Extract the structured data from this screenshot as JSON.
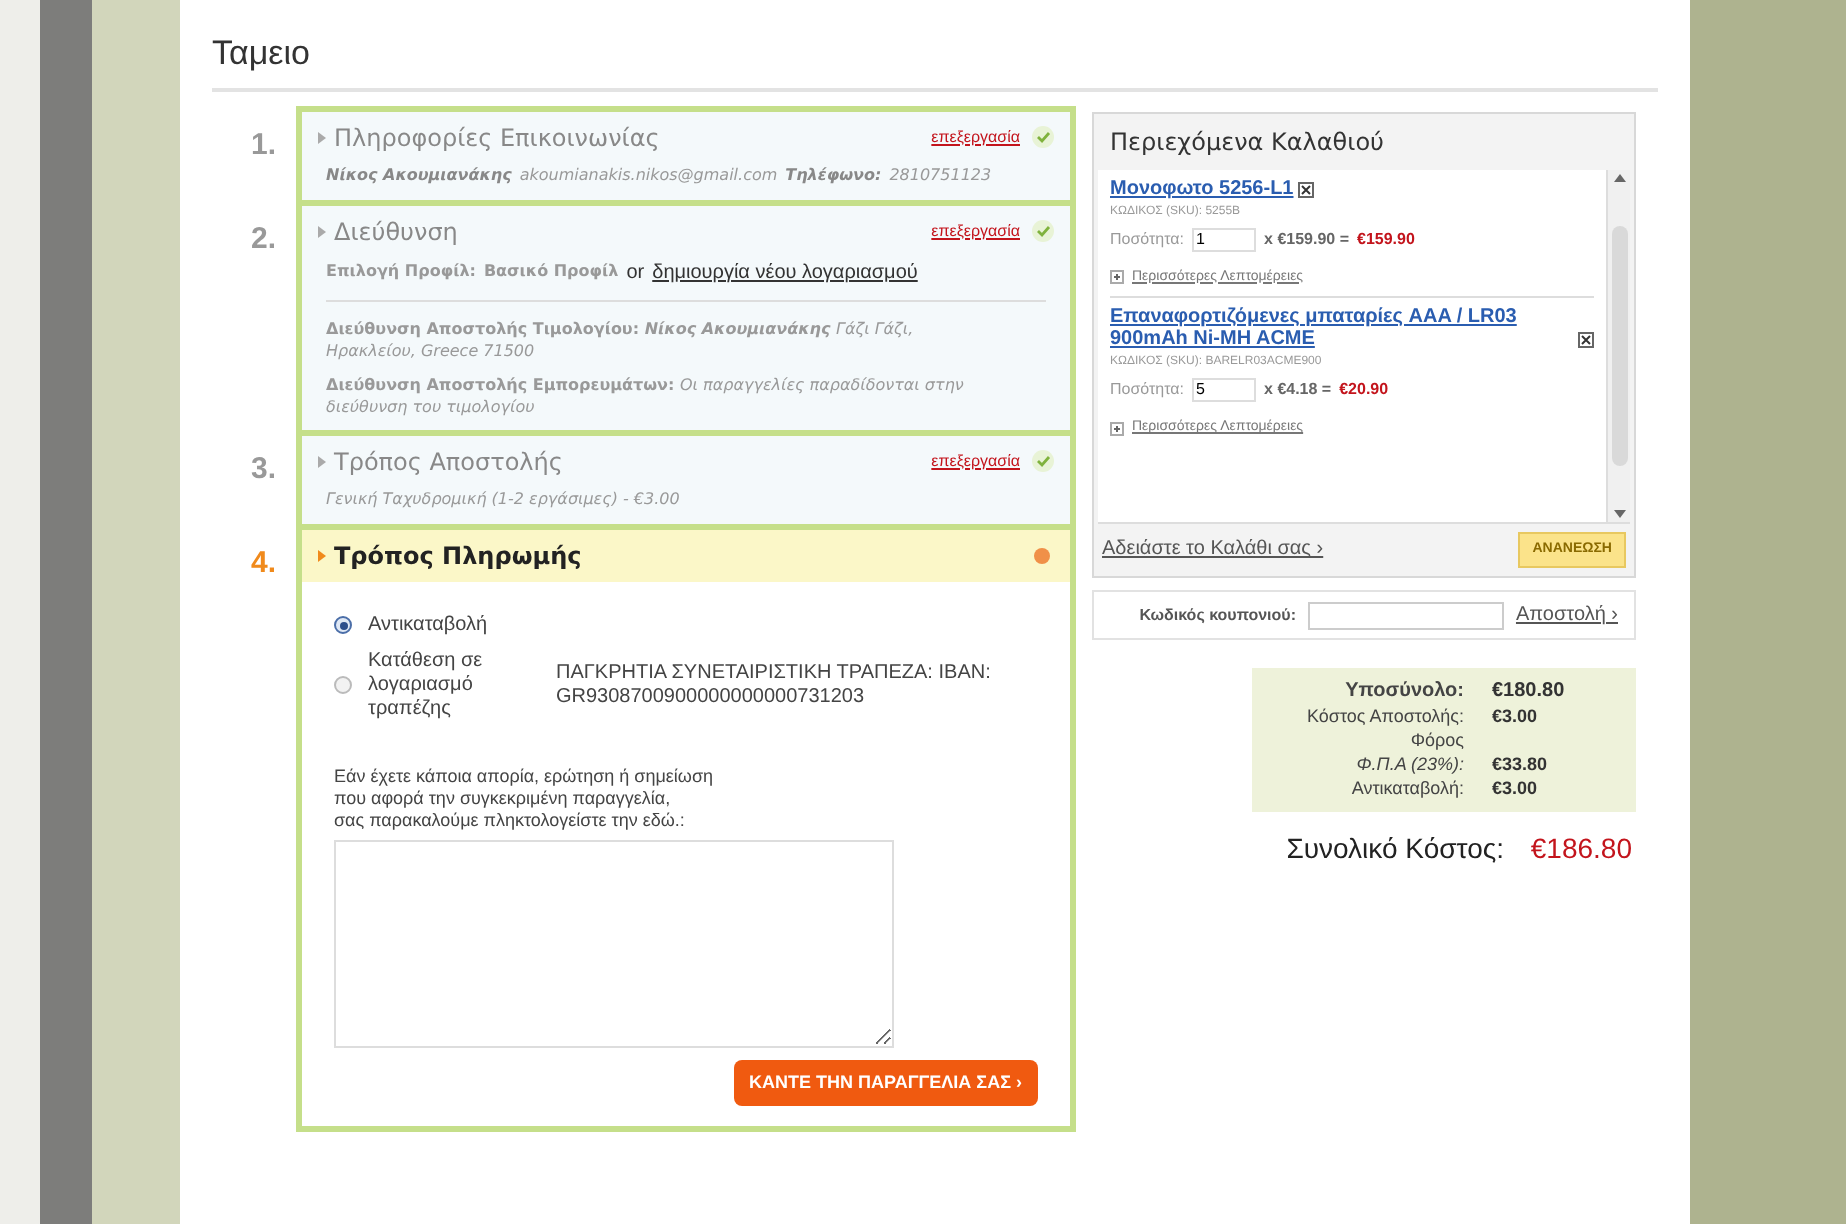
{
  "page_title": "Ταμειο",
  "steps": [
    {
      "number": "1.",
      "title": "Πληροφορίες Επικοινωνίας",
      "completed": true,
      "active": false,
      "edit_link": "επεξεργασία",
      "kind": "contact",
      "name": "Νίκος Ακουμιανάκης",
      "email": "akoumianakis.nikos@gmail.com",
      "phone_label": "Τηλέφωνο:",
      "phone": "2810751123"
    },
    {
      "number": "2.",
      "title": "Διεύθυνση",
      "completed": true,
      "active": false,
      "edit_link": "επεξεργασία",
      "kind": "address",
      "profile_label": "Επιλογή Προφίλ:",
      "profile_value": "Βασικό Προφίλ",
      "or": "or",
      "new_account_link": "δημιουργία νέου λογαριασμού",
      "billing_label": "Διεύθυνση Αποστολής Τιμολογίου:",
      "billing_name": "Νίκος Ακουμιανάκης",
      "billing_address": "Γάζι Γάζι, Ηρακλείου, Greece 71500",
      "shipping_label": "Διεύθυνση Αποστολής Εμπορευμάτων:",
      "shipping_note": "Οι παραγγελίες παραδίδονται στην διεύθυνση του τιμολογίου"
    },
    {
      "number": "3.",
      "title": "Τρόπος Αποστολής",
      "completed": true,
      "active": false,
      "edit_link": "επεξεργασία",
      "kind": "shipping",
      "method": "Γενική Ταχυδρομική (1-2 εργάσιμες) - €3.00"
    },
    {
      "number": "4.",
      "title": "Τρόπος Πληρωμής",
      "completed": false,
      "active": true,
      "kind": "payment",
      "options": [
        {
          "label": "Αντικαταβολή",
          "selected": true
        },
        {
          "label": "Κατάθεση σε λογαριασμό τραπέζης",
          "detail": "ΠΑΓΚΡΗΤΙΑ ΣΥΝΕΤΑΙΡΙΣΤΙΚΗ ΤΡΑΠΕΖΑ: IBAN: GR9308700900000000000731203",
          "selected": false
        }
      ],
      "note_lines": [
        "Εάν έχετε κάποια απορία, ερώτηση ή σημείωση",
        "που αφορά την συγκεκριμένη παραγγελία,",
        "σας παρακαλούμε πληκτολογείστε την εδώ.:"
      ],
      "button": "ΚΑΝΤΕ ΤΗΝ ΠΑΡΑΓΓΕΛΙΑ ΣΑΣ ›"
    }
  ],
  "cart": {
    "title": "Περιεχόμενα Καλαθιού",
    "items": [
      {
        "title": "Μονοφωτο 5256-L1",
        "sku": "ΚΩΔΙΚΟΣ (SKU): 5255B",
        "qty_label": "Ποσότητα:",
        "qty": "1",
        "unit": "x €159.90 =",
        "total": "€159.90",
        "more": "Περισσότερες Λεπτομέρειες"
      },
      {
        "title": "Επαναφορτιζόμενες μπαταρίες AAA / LR03 900mAh Ni-MH ACME",
        "sku": "ΚΩΔΙΚΟΣ (SKU): BARELR03ACME900",
        "qty_label": "Ποσότητα:",
        "qty": "5",
        "unit": "x €4.18 =",
        "total": "€20.90",
        "more": "Περισσότερες Λεπτομέρειες"
      }
    ],
    "empty_link": "Αδειάστε το Καλάθι σας ›",
    "update_button": "ΑΝΑΝΕΩΣΗ"
  },
  "coupon": {
    "label": "Κωδικός κουπονιού:",
    "submit": "Αποστολή ›"
  },
  "totals": [
    {
      "label": "Υποσύνολο:",
      "value": "€180.80",
      "bold": true
    },
    {
      "label": "Κόστος Αποστολής:",
      "value": "€3.00",
      "bold": false
    },
    {
      "label": "Φόρος",
      "bold": false
    },
    {
      "label": "Φ.Π.Α (23%):",
      "value": "€33.80",
      "bold": false,
      "italic": true
    },
    {
      "label": "Αντικαταβολή:",
      "value": "€3.00",
      "bold": false
    }
  ],
  "grand_total": {
    "label": "Συνολικό Κόστος:",
    "value": "€186.80"
  }
}
